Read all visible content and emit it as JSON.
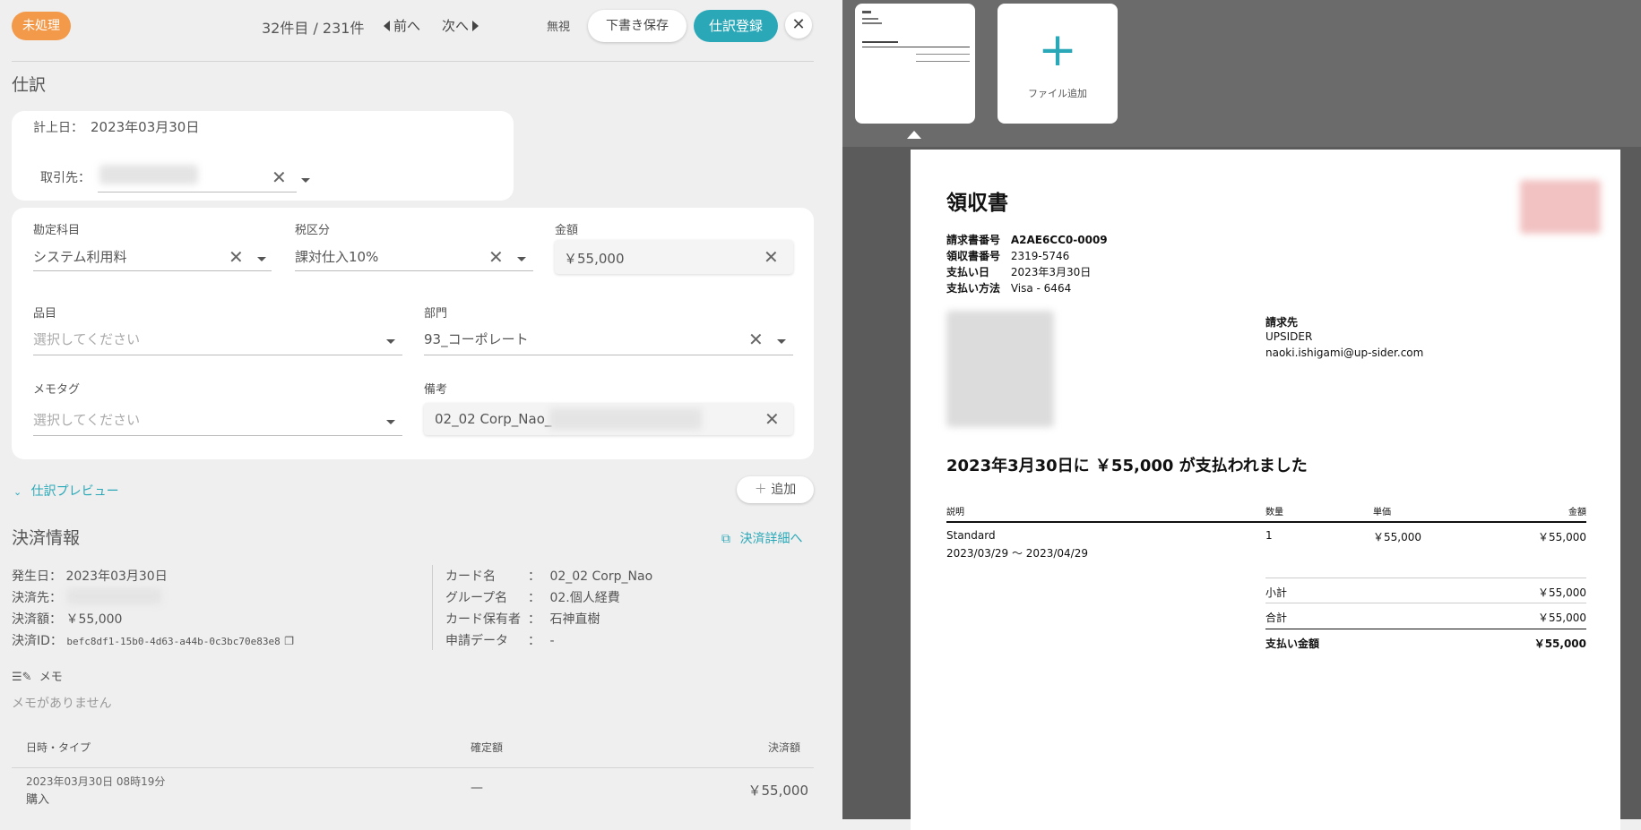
{
  "header": {
    "status": "未処理",
    "counter": "32件目 / 231件",
    "prev": "前へ",
    "next": "次へ",
    "ignore": "無視",
    "draft_save": "下書き保存",
    "register": "仕訳登録",
    "close": "✕"
  },
  "journal": {
    "title": "仕訳",
    "date_label": "計上日：",
    "date_value": "2023年03月30日",
    "partner_label": "取引先：",
    "account_label": "勘定科目",
    "account_value": "システム利用料",
    "tax_label": "税区分",
    "tax_value": "課対仕入10%",
    "amount_label": "金額",
    "amount_value": "￥55,000",
    "item_label": "品目",
    "item_placeholder": "選択してください",
    "dept_label": "部門",
    "dept_value": "93_コーポレート",
    "memotag_label": "メモタグ",
    "memotag_placeholder": "選択してください",
    "note_label": "備考",
    "note_value": "02_02 Corp_Nao_",
    "preview_label": "仕訳プレビュー",
    "add_label": "追加"
  },
  "payment": {
    "title": "決済情報",
    "detail_link": "決済詳細へ",
    "left": [
      {
        "key": "発生日：",
        "value": "2023年03月30日"
      },
      {
        "key": "決済先：",
        "value": ""
      },
      {
        "key": "決済額：",
        "value": "￥55,000"
      },
      {
        "key": "決済ID：",
        "value": "befc8df1-15b0-4d63-a44b-0c3bc70e83e8"
      }
    ],
    "right": [
      {
        "key": "カード名",
        "value": "02_02 Corp_Nao"
      },
      {
        "key": "グループ名",
        "value": "02.個人経費"
      },
      {
        "key": "カード保有者",
        "value": "石神直樹"
      },
      {
        "key": "申請データ",
        "value": "-"
      }
    ],
    "memo_label": "メモ",
    "memo_empty": "メモがありません",
    "table_headers": [
      "日時・タイプ",
      "確定額",
      "決済額"
    ],
    "rows": [
      {
        "datetime": "2023年03月30日 08時19分",
        "type": "購入",
        "confirmed": "—",
        "amount": "￥55,000"
      }
    ]
  },
  "viewer": {
    "add_file": "ファイル追加"
  },
  "receipt": {
    "title": "領収書",
    "meta": [
      {
        "key": "請求書番号",
        "value": "A2AE6CC0-0009"
      },
      {
        "key": "領収書番号",
        "value": "2319-5746"
      },
      {
        "key": "支払い日",
        "value": "2023年3月30日"
      },
      {
        "key": "支払い方法",
        "value": "Visa - 6464"
      }
    ],
    "billing_label": "請求先",
    "billing_name": "UPSIDER",
    "billing_email": "naoki.ishigami@up-sider.com",
    "headline": "2023年3月30日に ￥55,000 が支払われました",
    "table_headers": [
      "説明",
      "数量",
      "単価",
      "金額"
    ],
    "line_item": {
      "desc": "Standard",
      "period": "2023/03/29 〜 2023/04/29",
      "qty": "1",
      "unit": "￥55,000",
      "amount": "￥55,000"
    },
    "subtotal_label": "小計",
    "subtotal_value": "￥55,000",
    "total_label": "合計",
    "total_value": "￥55,000",
    "paid_label": "支払い金額",
    "paid_value": "￥55,000"
  }
}
